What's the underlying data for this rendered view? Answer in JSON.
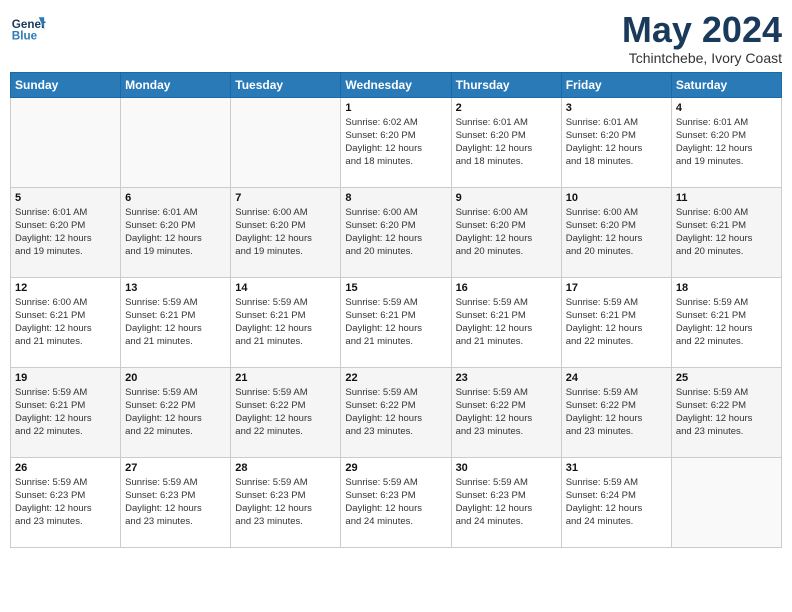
{
  "header": {
    "logo_line1": "General",
    "logo_line2": "Blue",
    "title": "May 2024",
    "subtitle": "Tchintchebe, Ivory Coast"
  },
  "weekdays": [
    "Sunday",
    "Monday",
    "Tuesday",
    "Wednesday",
    "Thursday",
    "Friday",
    "Saturday"
  ],
  "weeks": [
    [
      {
        "day": "",
        "info": ""
      },
      {
        "day": "",
        "info": ""
      },
      {
        "day": "",
        "info": ""
      },
      {
        "day": "1",
        "info": "Sunrise: 6:02 AM\nSunset: 6:20 PM\nDaylight: 12 hours\nand 18 minutes."
      },
      {
        "day": "2",
        "info": "Sunrise: 6:01 AM\nSunset: 6:20 PM\nDaylight: 12 hours\nand 18 minutes."
      },
      {
        "day": "3",
        "info": "Sunrise: 6:01 AM\nSunset: 6:20 PM\nDaylight: 12 hours\nand 18 minutes."
      },
      {
        "day": "4",
        "info": "Sunrise: 6:01 AM\nSunset: 6:20 PM\nDaylight: 12 hours\nand 19 minutes."
      }
    ],
    [
      {
        "day": "5",
        "info": "Sunrise: 6:01 AM\nSunset: 6:20 PM\nDaylight: 12 hours\nand 19 minutes."
      },
      {
        "day": "6",
        "info": "Sunrise: 6:01 AM\nSunset: 6:20 PM\nDaylight: 12 hours\nand 19 minutes."
      },
      {
        "day": "7",
        "info": "Sunrise: 6:00 AM\nSunset: 6:20 PM\nDaylight: 12 hours\nand 19 minutes."
      },
      {
        "day": "8",
        "info": "Sunrise: 6:00 AM\nSunset: 6:20 PM\nDaylight: 12 hours\nand 20 minutes."
      },
      {
        "day": "9",
        "info": "Sunrise: 6:00 AM\nSunset: 6:20 PM\nDaylight: 12 hours\nand 20 minutes."
      },
      {
        "day": "10",
        "info": "Sunrise: 6:00 AM\nSunset: 6:20 PM\nDaylight: 12 hours\nand 20 minutes."
      },
      {
        "day": "11",
        "info": "Sunrise: 6:00 AM\nSunset: 6:21 PM\nDaylight: 12 hours\nand 20 minutes."
      }
    ],
    [
      {
        "day": "12",
        "info": "Sunrise: 6:00 AM\nSunset: 6:21 PM\nDaylight: 12 hours\nand 21 minutes."
      },
      {
        "day": "13",
        "info": "Sunrise: 5:59 AM\nSunset: 6:21 PM\nDaylight: 12 hours\nand 21 minutes."
      },
      {
        "day": "14",
        "info": "Sunrise: 5:59 AM\nSunset: 6:21 PM\nDaylight: 12 hours\nand 21 minutes."
      },
      {
        "day": "15",
        "info": "Sunrise: 5:59 AM\nSunset: 6:21 PM\nDaylight: 12 hours\nand 21 minutes."
      },
      {
        "day": "16",
        "info": "Sunrise: 5:59 AM\nSunset: 6:21 PM\nDaylight: 12 hours\nand 21 minutes."
      },
      {
        "day": "17",
        "info": "Sunrise: 5:59 AM\nSunset: 6:21 PM\nDaylight: 12 hours\nand 22 minutes."
      },
      {
        "day": "18",
        "info": "Sunrise: 5:59 AM\nSunset: 6:21 PM\nDaylight: 12 hours\nand 22 minutes."
      }
    ],
    [
      {
        "day": "19",
        "info": "Sunrise: 5:59 AM\nSunset: 6:21 PM\nDaylight: 12 hours\nand 22 minutes."
      },
      {
        "day": "20",
        "info": "Sunrise: 5:59 AM\nSunset: 6:22 PM\nDaylight: 12 hours\nand 22 minutes."
      },
      {
        "day": "21",
        "info": "Sunrise: 5:59 AM\nSunset: 6:22 PM\nDaylight: 12 hours\nand 22 minutes."
      },
      {
        "day": "22",
        "info": "Sunrise: 5:59 AM\nSunset: 6:22 PM\nDaylight: 12 hours\nand 23 minutes."
      },
      {
        "day": "23",
        "info": "Sunrise: 5:59 AM\nSunset: 6:22 PM\nDaylight: 12 hours\nand 23 minutes."
      },
      {
        "day": "24",
        "info": "Sunrise: 5:59 AM\nSunset: 6:22 PM\nDaylight: 12 hours\nand 23 minutes."
      },
      {
        "day": "25",
        "info": "Sunrise: 5:59 AM\nSunset: 6:22 PM\nDaylight: 12 hours\nand 23 minutes."
      }
    ],
    [
      {
        "day": "26",
        "info": "Sunrise: 5:59 AM\nSunset: 6:23 PM\nDaylight: 12 hours\nand 23 minutes."
      },
      {
        "day": "27",
        "info": "Sunrise: 5:59 AM\nSunset: 6:23 PM\nDaylight: 12 hours\nand 23 minutes."
      },
      {
        "day": "28",
        "info": "Sunrise: 5:59 AM\nSunset: 6:23 PM\nDaylight: 12 hours\nand 23 minutes."
      },
      {
        "day": "29",
        "info": "Sunrise: 5:59 AM\nSunset: 6:23 PM\nDaylight: 12 hours\nand 24 minutes."
      },
      {
        "day": "30",
        "info": "Sunrise: 5:59 AM\nSunset: 6:23 PM\nDaylight: 12 hours\nand 24 minutes."
      },
      {
        "day": "31",
        "info": "Sunrise: 5:59 AM\nSunset: 6:24 PM\nDaylight: 12 hours\nand 24 minutes."
      },
      {
        "day": "",
        "info": ""
      }
    ]
  ]
}
